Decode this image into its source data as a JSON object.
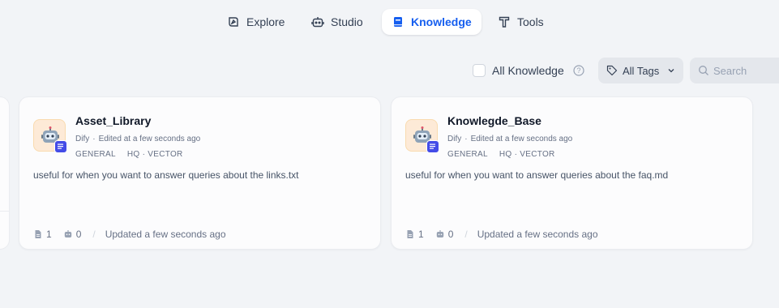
{
  "nav": {
    "items": [
      {
        "label": "Explore",
        "icon": "compass-icon",
        "active": false
      },
      {
        "label": "Studio",
        "icon": "robot-icon",
        "active": false
      },
      {
        "label": "Knowledge",
        "icon": "book-icon",
        "active": true
      },
      {
        "label": "Tools",
        "icon": "hammer-icon",
        "active": false
      }
    ]
  },
  "filters": {
    "all_knowledge_label": "All Knowledge",
    "all_knowledge_checked": false,
    "tags_label": "All Tags",
    "search_placeholder": "Search"
  },
  "cards": [
    {
      "title": "Asset_Library",
      "author": "Dify",
      "edited": "Edited at a few seconds ago",
      "tag_mode": "GENERAL",
      "tag_index": "HQ · VECTOR",
      "description": "useful for when you want to answer queries about the links.txt",
      "doc_count": "1",
      "app_count": "0",
      "updated": "Updated a few seconds ago"
    },
    {
      "title": "Knowlegde_Base",
      "author": "Dify",
      "edited": "Edited at a few seconds ago",
      "tag_mode": "GENERAL",
      "tag_index": "HQ · VECTOR",
      "description": "useful for when you want to answer queries about the faq.md",
      "doc_count": "1",
      "app_count": "0",
      "updated": "Updated a few seconds ago"
    }
  ],
  "colors": {
    "background": "#f2f4f7",
    "accent": "#155eef",
    "avatar_bg": "#fdead7",
    "badge": "#444ce7"
  }
}
